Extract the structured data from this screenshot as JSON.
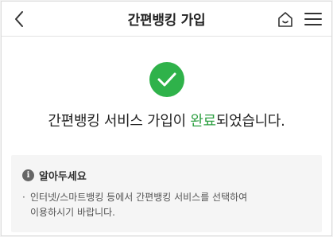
{
  "header": {
    "title": "간편뱅킹 가입",
    "back_icon": "chevron-left-icon",
    "home_icon": "home-icon",
    "menu_icon": "hamburger-menu-icon"
  },
  "result": {
    "icon": "check-circle-icon",
    "icon_color": "#2fb24a",
    "message_before": "간편뱅킹 서비스 가입이 ",
    "message_highlight": "완료",
    "message_after": "되었습니다.",
    "highlight_color": "#2fa043"
  },
  "notice": {
    "icon": "info-icon",
    "icon_glyph": "i",
    "title": "알아두세요",
    "bullet": "·",
    "line1": "인터넷/스마트뱅킹 등에서 간편뱅킹 서비스를 선택하여",
    "line2": "이용하시기 바랍니다."
  }
}
